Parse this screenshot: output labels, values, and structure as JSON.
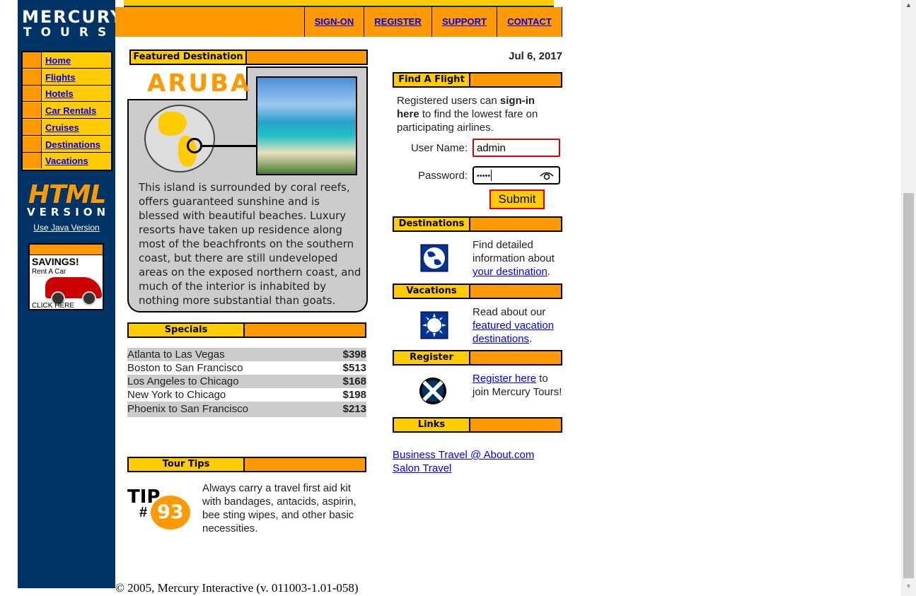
{
  "logo": {
    "line1": "MERCURY",
    "line2": "TOURS"
  },
  "topnav": [
    {
      "label": "SIGN-ON"
    },
    {
      "label": "REGISTER"
    },
    {
      "label": "SUPPORT"
    },
    {
      "label": "CONTACT"
    }
  ],
  "sidebar": {
    "items": [
      {
        "label": "Home"
      },
      {
        "label": "Flights"
      },
      {
        "label": "Hotels"
      },
      {
        "label": "Car Rentals"
      },
      {
        "label": "Cruises"
      },
      {
        "label": "Destinations"
      },
      {
        "label": "Vacations"
      }
    ],
    "html_version": {
      "big": "HTML",
      "small": "VERSION"
    },
    "java_link": "Use Java Version",
    "ad": {
      "title": "SAVINGS!",
      "subtitle": "Rent A Car",
      "cta": "CLICK HERE"
    }
  },
  "featured": {
    "header": "Featured Destination",
    "name": "ARUBA",
    "text": "This island is surrounded by coral reefs, offers guaranteed sunshine and is blessed with beautiful beaches. Luxury resorts have taken up residence along most of the beachfronts on the southern coast, but there are still undeveloped areas on the exposed northern coast, and much of the interior is inhabited by nothing more substantial than goats."
  },
  "specials": {
    "header": "Specials",
    "rows": [
      {
        "route": "Atlanta to Las Vegas",
        "price": "$398"
      },
      {
        "route": "Boston to San Francisco",
        "price": "$513"
      },
      {
        "route": "Los Angeles to Chicago",
        "price": "$168"
      },
      {
        "route": "New York to Chicago",
        "price": "$198"
      },
      {
        "route": "Phoenix to San Francisco",
        "price": "$213"
      }
    ]
  },
  "tips": {
    "header": "Tour Tips",
    "tip_word": "TIP",
    "tip_hash": "#",
    "tip_number": "93",
    "text": "Always carry a travel first aid kit with bandages, antacids, aspirin, bee sting wipes, and other basic necessities."
  },
  "date": "Jul 6, 2017",
  "find_flight": {
    "header": "Find A Flight",
    "text_pre": "Registered users can ",
    "text_bold": "sign-in here",
    "text_post": " to find the lowest fare on participating airlines.",
    "username_label": "User Name:",
    "username_value": "admin",
    "password_label": "Password:",
    "password_value": "•••••",
    "submit_label": "Submit"
  },
  "destinations": {
    "header": "Destinations",
    "text_pre": "Find detailed information about ",
    "link": "your destination",
    "text_post": "."
  },
  "vacations": {
    "header": "Vacations",
    "text_pre": "Read about our ",
    "link": "featured vacation destinations",
    "text_post": "."
  },
  "register": {
    "header": "Register",
    "link": "Register here",
    "text_post": " to join Mercury Tours!"
  },
  "links": {
    "header": "Links",
    "items": [
      "Business Travel @ About.com",
      "Salon Travel"
    ]
  },
  "footer": "© 2005, Mercury Interactive (v. 011003-1.01-058)",
  "colors": {
    "navy": "#003366",
    "orange": "#ff9900",
    "yellow": "#ffcc00",
    "link": "#0000ff"
  }
}
